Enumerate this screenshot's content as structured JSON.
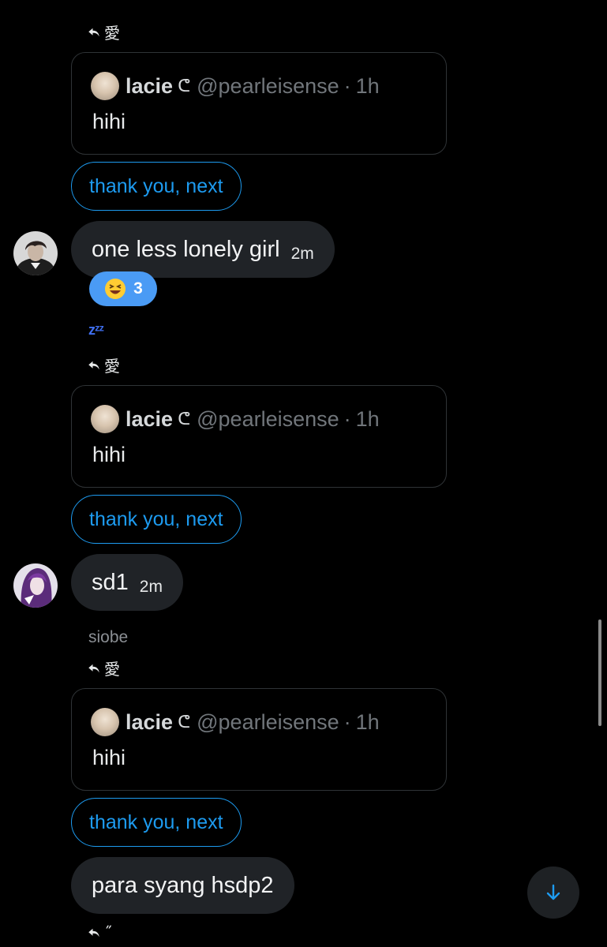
{
  "reply_target": "愛",
  "reply_target_partial": "˝",
  "quote": {
    "name": "lacie",
    "flourish": "ᕦ",
    "handle": "@pearleisense",
    "separator": "·",
    "time": "1h",
    "text": "hihi"
  },
  "quick_reply_label": "thank you, next",
  "messages": [
    {
      "text": "one less lonely girl",
      "time": "2m"
    },
    {
      "text": "sd1",
      "time": "2m"
    },
    {
      "text": "para syang hsdp2",
      "time": ""
    }
  ],
  "reaction": {
    "emoji": "laughing-face",
    "count": "3"
  },
  "typing_indicator": "zᶻᶻ",
  "sender_name": "siobe",
  "colors": {
    "background": "#000000",
    "bubble": "#202327",
    "accent": "#1d9bf0",
    "reaction": "#4a9bf5",
    "muted": "#71767b"
  }
}
